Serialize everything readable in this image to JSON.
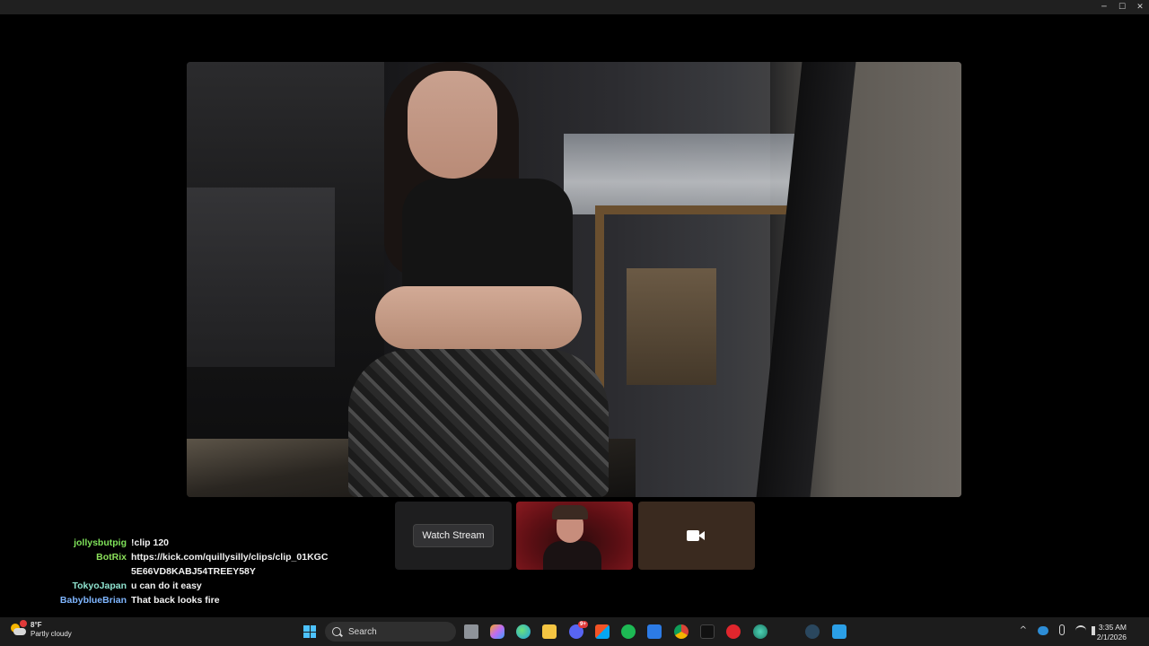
{
  "window": {
    "minimize_glyph": "─",
    "maximize_glyph": "☐",
    "close_glyph": "✕"
  },
  "tiles": {
    "watch_label": "Watch Stream"
  },
  "chat": {
    "messages": [
      {
        "user": "jollysbutpig",
        "color": "#7fe35a",
        "text": "!clip 120"
      },
      {
        "user": "BotRix",
        "color": "#8be05a",
        "text": "https://kick.com/quillysilly/clips/clip_01KGC5E66VD8KABJ54TREEY58Y"
      },
      {
        "user": "TokyoJapan",
        "color": "#8fe3cf",
        "text": "u can do it easy"
      },
      {
        "user": "BabyblueBrian",
        "color": "#7fb6ff",
        "text": "That back looks fire"
      }
    ]
  },
  "taskbar": {
    "weather": {
      "temp": "8°F",
      "condition": "Partly cloudy",
      "badge": "1"
    },
    "search_label": "Search",
    "apps": [
      {
        "name": "task-view-icon",
        "color": "#9aa0a6"
      },
      {
        "name": "copilot-icon",
        "color": "#c06cf0"
      },
      {
        "name": "edge-icon",
        "color": "#1fa3e0"
      },
      {
        "name": "file-explorer-icon",
        "color": "#f4c542"
      },
      {
        "name": "discord-icon",
        "color": "#5865f2"
      },
      {
        "name": "store-icon",
        "color": "#4a90e2"
      },
      {
        "name": "spotify-icon",
        "color": "#1db954"
      },
      {
        "name": "mail-icon",
        "color": "#2c7be5"
      },
      {
        "name": "chrome-icon",
        "color": "#dcdcdc"
      },
      {
        "name": "tiktok-icon",
        "color": "#111111"
      },
      {
        "name": "opera-icon",
        "color": "#e0262d"
      },
      {
        "name": "globe-icon",
        "color": "#2ba58c"
      },
      {
        "name": "steam-icon",
        "color": "#1b2838"
      },
      {
        "name": "f-app-icon",
        "color": "#2b9fe6"
      }
    ],
    "discord_badge": "9+",
    "tray": {
      "chevron": "^",
      "time": "3:35 AM",
      "date": "2/1/2026"
    }
  }
}
